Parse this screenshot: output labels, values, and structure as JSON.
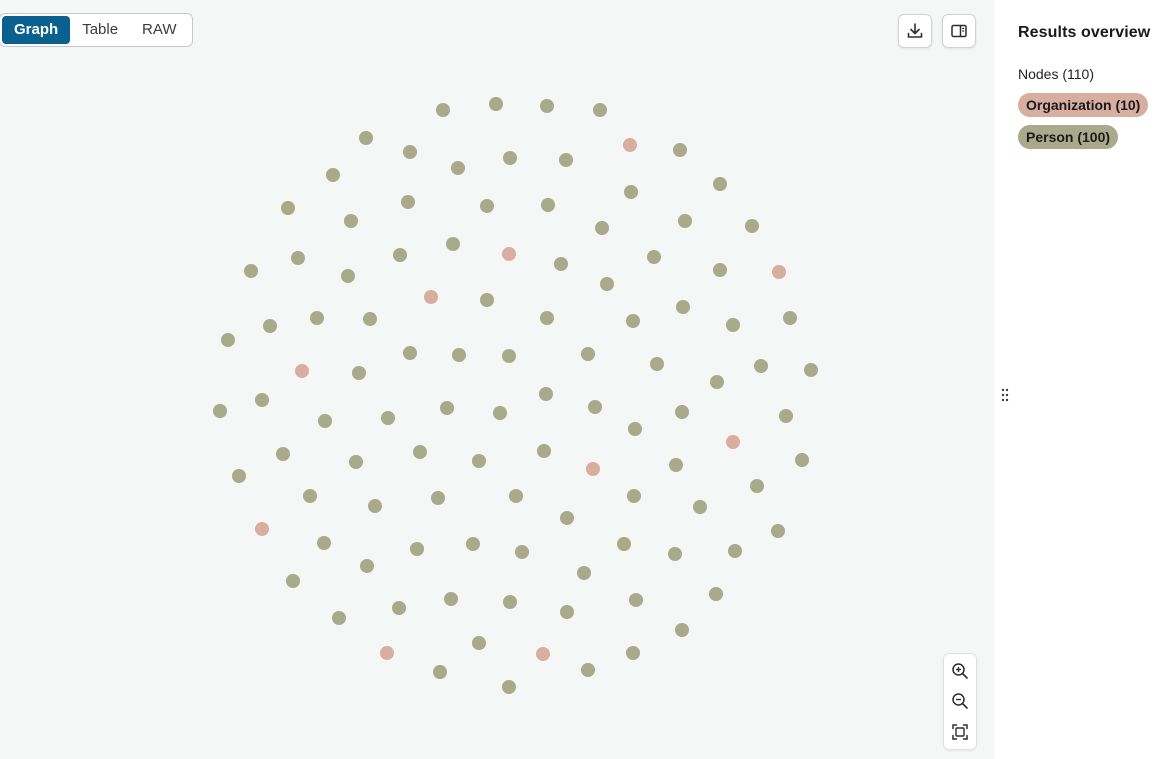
{
  "view_toggle": {
    "tabs": [
      "Graph",
      "Table",
      "RAW"
    ],
    "selected": "Graph"
  },
  "toolbar": {
    "download_icon": "download-icon",
    "sidebar_icon": "sidebar-toggle-icon"
  },
  "zoom_controls": {
    "zoom_in_icon": "zoom-in-icon",
    "zoom_out_icon": "zoom-out-icon",
    "fit_icon": "fit-to-screen-icon"
  },
  "results_panel": {
    "title": "Results overview",
    "nodes_label": "Nodes (110)",
    "labels": [
      {
        "text": "Organization (10)",
        "color": "#d8aea0"
      },
      {
        "text": "Person (100)",
        "color": "#a9a98b"
      }
    ]
  },
  "colors": {
    "accent": "#0a6190",
    "person_node": "#a9a98b",
    "organization_node": "#d8aea0",
    "canvas_bg": "#f5f6f6"
  }
}
